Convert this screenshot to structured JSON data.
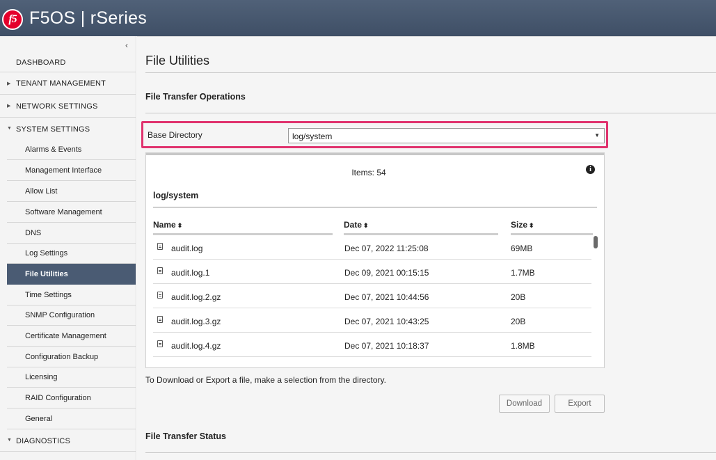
{
  "header": {
    "logo_text": "f5",
    "title": "F5OS | rSeries"
  },
  "sidebar": {
    "collapse_glyph": "‹",
    "top_items": [
      {
        "label": "DASHBOARD",
        "arrow": ""
      },
      {
        "label": "TENANT MANAGEMENT",
        "arrow": "▶"
      },
      {
        "label": "NETWORK SETTINGS",
        "arrow": "▶"
      },
      {
        "label": "SYSTEM SETTINGS",
        "arrow": "▼"
      }
    ],
    "system_items": [
      {
        "label": "Alarms & Events"
      },
      {
        "label": "Management Interface"
      },
      {
        "label": "Allow List"
      },
      {
        "label": "Software Management"
      },
      {
        "label": "DNS"
      },
      {
        "label": "Log Settings"
      },
      {
        "label": "File Utilities",
        "active": true
      },
      {
        "label": "Time Settings"
      },
      {
        "label": "SNMP Configuration"
      },
      {
        "label": "Certificate Management"
      },
      {
        "label": "Configuration Backup"
      },
      {
        "label": "Licensing"
      },
      {
        "label": "RAID Configuration"
      },
      {
        "label": "General"
      }
    ],
    "diagnostics": {
      "label": "DIAGNOSTICS",
      "arrow": "▼"
    }
  },
  "main": {
    "page_title": "File Utilities",
    "transfer_ops_title": "File Transfer Operations",
    "base_directory": {
      "label": "Base Directory",
      "value": "log/system",
      "caret": "▼"
    },
    "panel": {
      "items_count": "Items: 54",
      "info_glyph": "i",
      "path": "log/system",
      "columns": {
        "name": "Name",
        "date": "Date",
        "size": "Size",
        "sort_glyph": "⬍"
      },
      "rows": [
        {
          "name": "audit.log",
          "date": "Dec 07, 2022 11:25:08",
          "size": "69MB"
        },
        {
          "name": "audit.log.1",
          "date": "Dec 09, 2021 00:15:15",
          "size": "1.7MB"
        },
        {
          "name": "audit.log.2.gz",
          "date": "Dec 07, 2021 10:44:56",
          "size": "20B"
        },
        {
          "name": "audit.log.3.gz",
          "date": "Dec 07, 2021 10:43:25",
          "size": "20B"
        },
        {
          "name": "audit.log.4.gz",
          "date": "Dec 07, 2021 10:18:37",
          "size": "1.8MB"
        }
      ]
    },
    "hint": "To Download or Export a file, make a selection from the directory.",
    "buttons": {
      "download": "Download",
      "export": "Export"
    },
    "transfer_status_title": "File Transfer Status"
  },
  "colors": {
    "header": "#46566d",
    "active_nav": "#4a5b73",
    "highlight_border": "#e0336e",
    "logo": "#e4002b"
  }
}
